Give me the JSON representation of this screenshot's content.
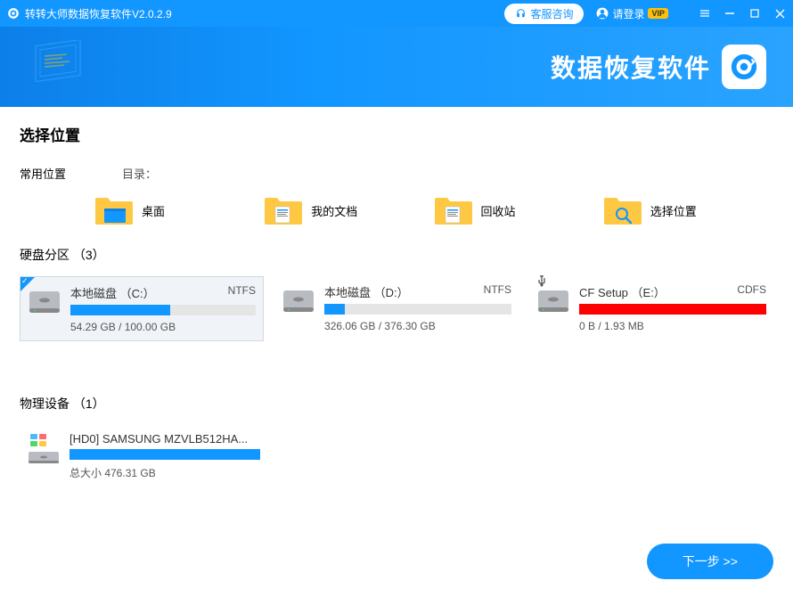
{
  "titlebar": {
    "title": "转转大师数据恢复软件V2.0.2.9",
    "service": "客服咨询",
    "login": "请登录",
    "vip": "VIP"
  },
  "banner": {
    "title": "数据恢复软件"
  },
  "page": {
    "title": "选择位置"
  },
  "common": {
    "label": "常用位置",
    "directory": "目录：",
    "items": [
      {
        "label": "桌面"
      },
      {
        "label": "我的文档"
      },
      {
        "label": "回收站"
      },
      {
        "label": "选择位置"
      }
    ]
  },
  "partitions": {
    "title": "硬盘分区 （3）",
    "items": [
      {
        "name": "本地磁盘 （C:）",
        "fs": "NTFS",
        "used": "54.29 GB / 100.00 GB",
        "fill_pct": 54,
        "color": "#1296ff",
        "selected": true,
        "usb": false
      },
      {
        "name": "本地磁盘 （D:）",
        "fs": "NTFS",
        "used": "326.06 GB / 376.30 GB",
        "fill_pct": 11,
        "color": "#1296ff",
        "selected": false,
        "usb": false
      },
      {
        "name": "CF Setup （E:）",
        "fs": "CDFS",
        "used": "0 B / 1.93 MB",
        "fill_pct": 100,
        "color": "#ff0000",
        "selected": false,
        "usb": true
      }
    ]
  },
  "devices": {
    "title": "物理设备 （1）",
    "items": [
      {
        "name": "[HD0] SAMSUNG MZVLB512HA...",
        "size": "总大小 476.31 GB",
        "fill_pct": 100,
        "color": "#1296ff"
      }
    ]
  },
  "next": "下一步 >>"
}
